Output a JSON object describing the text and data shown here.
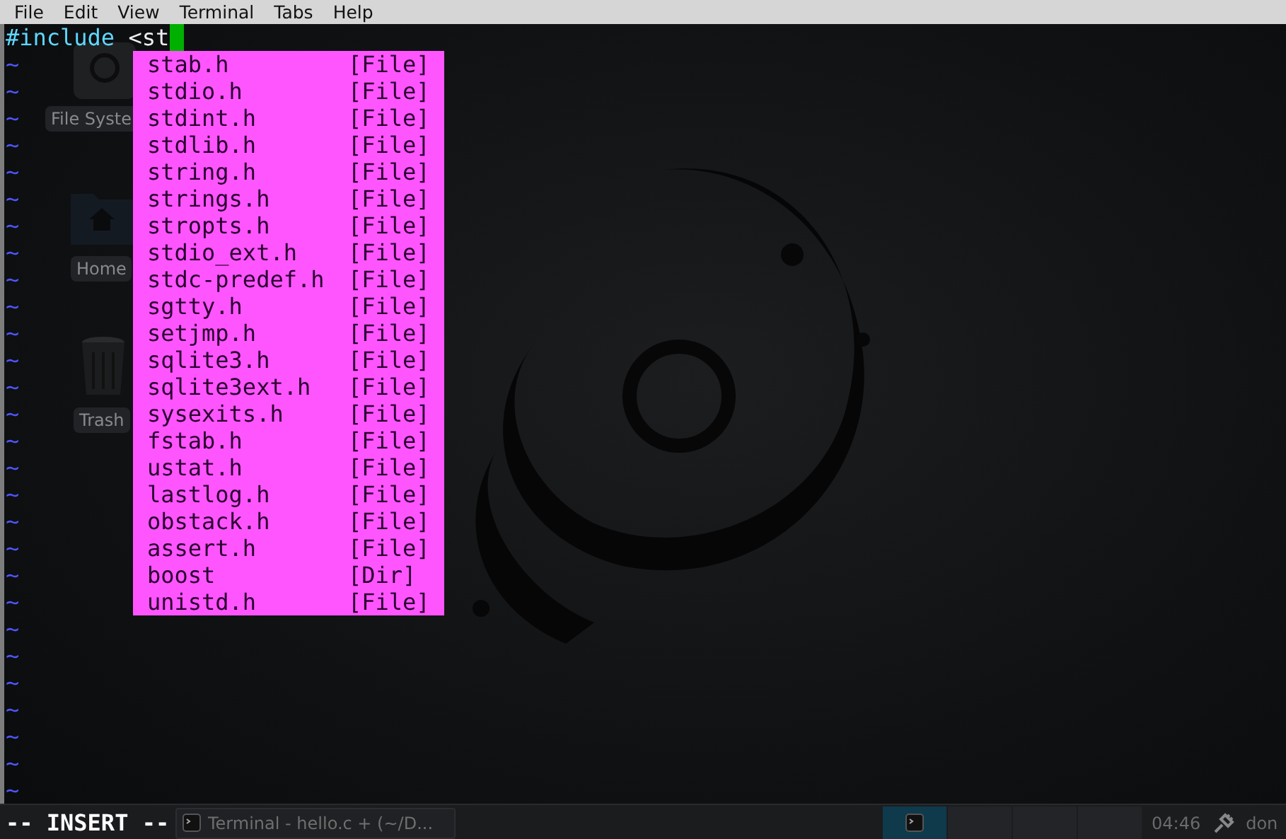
{
  "menu": [
    "File",
    "Edit",
    "View",
    "Terminal",
    "Tabs",
    "Help"
  ],
  "desktop_icons": [
    {
      "kind": "disk",
      "label": "File Syste"
    },
    {
      "kind": "home",
      "label": "Home"
    },
    {
      "kind": "trash",
      "label": "Trash"
    }
  ],
  "editor": {
    "directive": "#include",
    "text": " <st",
    "empty_lines": [
      "~",
      "~",
      "~",
      "~",
      "~",
      "~",
      "~",
      "~",
      "~",
      "~",
      "~",
      "~",
      "~",
      "~",
      "~",
      "~",
      "~",
      "~",
      "~",
      "~",
      "~",
      "~",
      "~",
      "~",
      "~",
      "~",
      "~",
      "~"
    ],
    "mode": "-- INSERT --"
  },
  "completion": [
    {
      "name": "stab.h",
      "type": "[File]"
    },
    {
      "name": "stdio.h",
      "type": "[File]"
    },
    {
      "name": "stdint.h",
      "type": "[File]"
    },
    {
      "name": "stdlib.h",
      "type": "[File]"
    },
    {
      "name": "string.h",
      "type": "[File]"
    },
    {
      "name": "strings.h",
      "type": "[File]"
    },
    {
      "name": "stropts.h",
      "type": "[File]"
    },
    {
      "name": "stdio_ext.h",
      "type": "[File]"
    },
    {
      "name": "stdc-predef.h",
      "type": "[File]"
    },
    {
      "name": "sgtty.h",
      "type": "[File]"
    },
    {
      "name": "setjmp.h",
      "type": "[File]"
    },
    {
      "name": "sqlite3.h",
      "type": "[File]"
    },
    {
      "name": "sqlite3ext.h",
      "type": "[File]"
    },
    {
      "name": "sysexits.h",
      "type": "[File]"
    },
    {
      "name": "fstab.h",
      "type": "[File]"
    },
    {
      "name": "ustat.h",
      "type": "[File]"
    },
    {
      "name": "lastlog.h",
      "type": "[File]"
    },
    {
      "name": "obstack.h",
      "type": "[File]"
    },
    {
      "name": "assert.h",
      "type": "[File]"
    },
    {
      "name": "boost",
      "type": "[Dir]"
    },
    {
      "name": "unistd.h",
      "type": "[File]"
    }
  ],
  "taskbar": {
    "tasks": [
      {
        "label": "Terminal - hello.c + (~/D..."
      }
    ],
    "workspaces": [
      {
        "selected": true
      },
      {
        "selected": false
      },
      {
        "selected": false
      },
      {
        "selected": false
      }
    ],
    "clock": "04:46",
    "user": "don"
  }
}
